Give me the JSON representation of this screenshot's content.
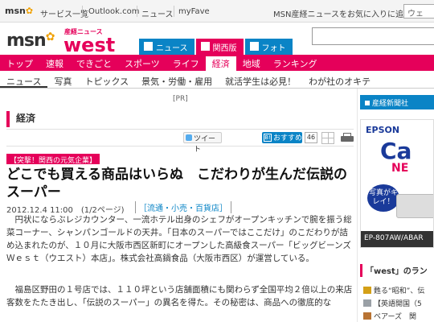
{
  "topbar": {
    "logo": "msn",
    "links": [
      "サービス一覧",
      "Outlook.com",
      "ニュース",
      "myFave"
    ],
    "favorite": "MSN産経ニュースをお気に入りに追加",
    "search_placeholder": "ウェ"
  },
  "brand": {
    "logo": "msn",
    "sub": "産経ニュース",
    "site": "west",
    "tabs": [
      "ニュース",
      "関西版",
      "フォト"
    ]
  },
  "mainnav": {
    "items": [
      "トップ",
      "速報",
      "できごと",
      "スポーツ",
      "ライフ",
      "経済",
      "地域",
      "ランキング"
    ],
    "active": "経済"
  },
  "subnav": {
    "items": [
      "ニュース",
      "写真",
      "トピックス",
      "景気・労働・雇用",
      "就活学生は必見！",
      "わが社のオキテ"
    ],
    "active": "ニュース"
  },
  "pr": "[PR]",
  "section": {
    "title": "経済"
  },
  "social": {
    "tweet": "ツイート",
    "hatena": "おすすめ",
    "hatena_count": "46"
  },
  "article": {
    "category": "【突撃！関西の元気企業】",
    "headline": "どこでも買える商品はいらぬ　こだわりが生んだ伝説のスーパー",
    "date": "2012.12.4 11:00",
    "page": "(1/2ページ)",
    "tag": "［流通・小売・百貨店］",
    "para1": "　円状にならぶレジカウンター、一流ホテル出身のシェフがオープンキッチンで腕を振う総菜コーナー、シャンパンゴールドの天井。「日本のスーパーではここだけ」のこだわりが詰め込まれたのが、１０月に大阪市西区新町にオープンした高級食スーパー「ビッグビーンズＷｅｓｔ（ウエスト）本店」。株式会社高鍋食品（大阪市西区）が運営している。",
    "para2": "　福島区野田の１号店では、１１０坪という店舗面積にも関わらず全国平均２倍以上の来店客数をたたき出し、「伝説のスーパー」の異名を得た。その秘密は、商品への徹底的な"
  },
  "right": {
    "sankei": "産経新聞社",
    "ad": {
      "brand": "EPSON",
      "big": "Ca",
      "ne": "NE",
      "bubble": "写真がキレイ！",
      "model": "EP-807AW/ABAR"
    },
    "ranking_title": "「west」のラン",
    "ranking": [
      "甦る“昭和”、伝",
      "【英語開国（5",
      "ベアーズ　関"
    ]
  },
  "colors": {
    "accent": "#e5005a",
    "blue": "#0a84c6",
    "epson": "#1a3a9a"
  }
}
